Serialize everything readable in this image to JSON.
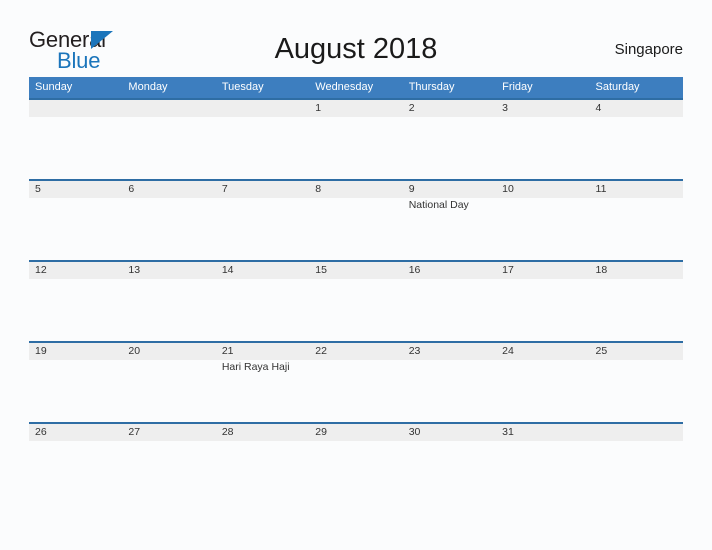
{
  "brand": {
    "word_one": "General",
    "word_two": "Blue",
    "triangle_icon": "triangle-icon",
    "accent_color": "#1b75bb"
  },
  "header": {
    "title": "August 2018",
    "region": "Singapore"
  },
  "theme": {
    "header_blue": "#3d7ebf",
    "row_rule_blue": "#2e6da4",
    "band_gray": "#eeeeee",
    "page_background": "#fbfcfd",
    "text_color": "#333333"
  },
  "calendar": {
    "weekday_headers": [
      "Sunday",
      "Monday",
      "Tuesday",
      "Wednesday",
      "Thursday",
      "Friday",
      "Saturday"
    ],
    "weeks": [
      {
        "band_span": 7,
        "days": [
          {
            "num": "",
            "event": ""
          },
          {
            "num": "",
            "event": ""
          },
          {
            "num": "",
            "event": ""
          },
          {
            "num": "1",
            "event": ""
          },
          {
            "num": "2",
            "event": ""
          },
          {
            "num": "3",
            "event": ""
          },
          {
            "num": "4",
            "event": ""
          }
        ]
      },
      {
        "band_span": 7,
        "days": [
          {
            "num": "5",
            "event": ""
          },
          {
            "num": "6",
            "event": ""
          },
          {
            "num": "7",
            "event": ""
          },
          {
            "num": "8",
            "event": ""
          },
          {
            "num": "9",
            "event": "National Day"
          },
          {
            "num": "10",
            "event": ""
          },
          {
            "num": "11",
            "event": ""
          }
        ]
      },
      {
        "band_span": 7,
        "days": [
          {
            "num": "12",
            "event": ""
          },
          {
            "num": "13",
            "event": ""
          },
          {
            "num": "14",
            "event": ""
          },
          {
            "num": "15",
            "event": ""
          },
          {
            "num": "16",
            "event": ""
          },
          {
            "num": "17",
            "event": ""
          },
          {
            "num": "18",
            "event": ""
          }
        ]
      },
      {
        "band_span": 7,
        "days": [
          {
            "num": "19",
            "event": ""
          },
          {
            "num": "20",
            "event": ""
          },
          {
            "num": "21",
            "event": "Hari Raya Haji"
          },
          {
            "num": "22",
            "event": ""
          },
          {
            "num": "23",
            "event": ""
          },
          {
            "num": "24",
            "event": ""
          },
          {
            "num": "25",
            "event": ""
          }
        ]
      },
      {
        "band_span": 7,
        "days": [
          {
            "num": "26",
            "event": ""
          },
          {
            "num": "27",
            "event": ""
          },
          {
            "num": "28",
            "event": ""
          },
          {
            "num": "29",
            "event": ""
          },
          {
            "num": "30",
            "event": ""
          },
          {
            "num": "31",
            "event": ""
          },
          {
            "num": "",
            "event": ""
          }
        ]
      }
    ]
  }
}
